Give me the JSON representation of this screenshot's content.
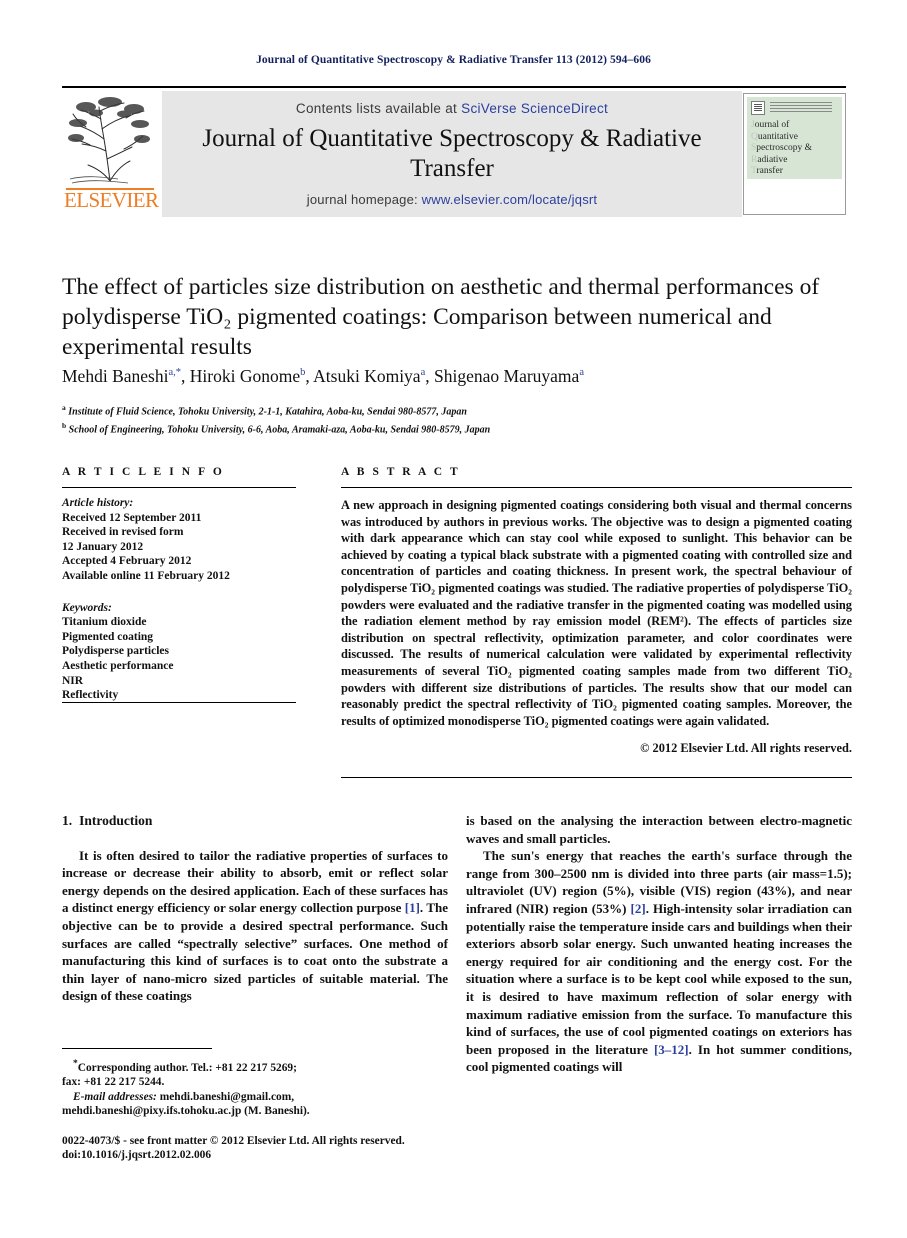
{
  "running_head": "Journal of Quantitative Spectroscopy & Radiative Transfer 113 (2012) 594–606",
  "masthead": {
    "contents_prefix": "Contents lists available at ",
    "sciencedirect": "SciVerse ScienceDirect",
    "journal_title": "Journal of Quantitative Spectroscopy & Radiative Transfer",
    "homepage_prefix": "journal homepage: ",
    "homepage_url": "www.elsevier.com/locate/jqsrt",
    "publisher": "ELSEVIER",
    "cover_title_lines": [
      "ournal of",
      "uantitative",
      "pectroscopy &",
      "adiative",
      "ransfer"
    ],
    "cover_dropcaps": [
      "J",
      "Q",
      "S",
      "R",
      "T"
    ],
    "link_color": "#2b3f9e",
    "brand_color": "#ef7d22",
    "band_color": "#e6e6e6"
  },
  "article": {
    "title": "The effect of particles size distribution on aesthetic and thermal performances of polydisperse TiO₂ pigmented coatings: Comparison between numerical and experimental results",
    "authors": [
      {
        "name": "Mehdi Baneshi",
        "marks": "a,*"
      },
      {
        "name": "Hiroki Gonome",
        "marks": "b"
      },
      {
        "name": "Atsuki Komiya",
        "marks": "a"
      },
      {
        "name": "Shigenao Maruyama",
        "marks": "a"
      }
    ],
    "affiliations": [
      {
        "mark": "a",
        "text": "Institute of Fluid Science, Tohoku University, 2-1-1, Katahira, Aoba-ku, Sendai 980-8577, Japan"
      },
      {
        "mark": "b",
        "text": "School of Engineering, Tohoku University, 6-6, Aoba, Aramaki-aza, Aoba-ku, Sendai 980-8579, Japan"
      }
    ]
  },
  "article_info": {
    "heading": "A R T I C L E  I N F O",
    "history_label": "Article history:",
    "history": [
      "Received 12 September 2011",
      "Received in revised form",
      "12 January 2012",
      "Accepted 4 February 2012",
      "Available online 11 February 2012"
    ],
    "keywords_label": "Keywords:",
    "keywords": [
      "Titanium dioxide",
      "Pigmented coating",
      "Polydisperse particles",
      "Aesthetic performance",
      "NIR",
      "Reflectivity"
    ]
  },
  "abstract": {
    "heading": "A B S T R A C T",
    "text": "A new approach in designing pigmented coatings considering both visual and thermal concerns was introduced by authors in previous works. The objective was to design a pigmented coating with dark appearance which can stay cool while exposed to sunlight. This behavior can be achieved by coating a typical black substrate with a pigmented coating with controlled size and concentration of particles and coating thickness. In present work, the spectral behaviour of polydisperse TiO₂ pigmented coatings was studied. The radiative properties of polydisperse TiO₂ powders were evaluated and the radiative transfer in the pigmented coating was modelled using the radiation element method by ray emission model (REM²). The effects of particles size distribution on spectral reflectivity, optimization parameter, and color coordinates were discussed. The results of numerical calculation were validated by experimental reflectivity measurements of several TiO₂ pigmented coating samples made from two different TiO₂ powders with different size distributions of particles. The results show that our model can reasonably predict the spectral reflectivity of TiO₂ pigmented coating samples. Moreover, the results of optimized monodisperse TiO₂ pigmented coatings were again validated.",
    "copyright": "© 2012 Elsevier Ltd. All rights reserved."
  },
  "body": {
    "section_number": "1.",
    "section_title": "Introduction",
    "left_para_1_a": "It is often desired to tailor the radiative properties of surfaces to increase or decrease their ability to absorb, emit or reflect solar energy depends on the desired application. Each of these surfaces has a distinct energy efficiency or solar energy collection purpose ",
    "left_cite_1": "[1]",
    "left_para_1_b": ". The objective can be to provide a desired spectral performance. Such surfaces are called “spectrally selective” surfaces. One method of manufacturing this kind of surfaces is to coat onto the substrate a thin layer of nano-micro sized particles of suitable material. The design of these coatings",
    "right_para_0": "is based on the analysing the interaction between electro-magnetic waves and small particles.",
    "right_para_1_a": "The sun's energy that reaches the earth's surface through the range from 300–2500 nm is divided into three parts (air mass=1.5); ultraviolet (UV) region (5%), visible (VIS) region (43%), and near infrared (NIR) region (53%) ",
    "right_cite_2": "[2]",
    "right_para_1_b": ". High-intensity solar irradiation can potentially raise the temperature inside cars and buildings when their exteriors absorb solar energy. Such unwanted heating increases the energy required for air conditioning and the energy cost. For the situation where a surface is to be kept cool while exposed to the sun, it is desired to have maximum reflection of solar energy with maximum radiative emission from the surface. To manufacture this kind of surfaces, the use of cool pigmented coatings on exteriors has been proposed in the literature ",
    "right_cite_3": "[3–12]",
    "right_para_1_c": ". In hot summer conditions, cool pigmented coatings will"
  },
  "footnote": {
    "corresponding": "Corresponding author. Tel.: +81 22 217 5269;",
    "fax": "fax: +81 22 217 5244.",
    "email_label": "E-mail addresses:",
    "email_1": "mehdi.baneshi@gmail.com,",
    "email_2": "mehdi.baneshi@pixy.ifs.tohoku.ac.jp (M. Baneshi)."
  },
  "imprint": {
    "line_1": "0022-4073/$ - see front matter © 2012 Elsevier Ltd. All rights reserved.",
    "line_2": "doi:10.1016/j.jqsrt.2012.02.006"
  }
}
